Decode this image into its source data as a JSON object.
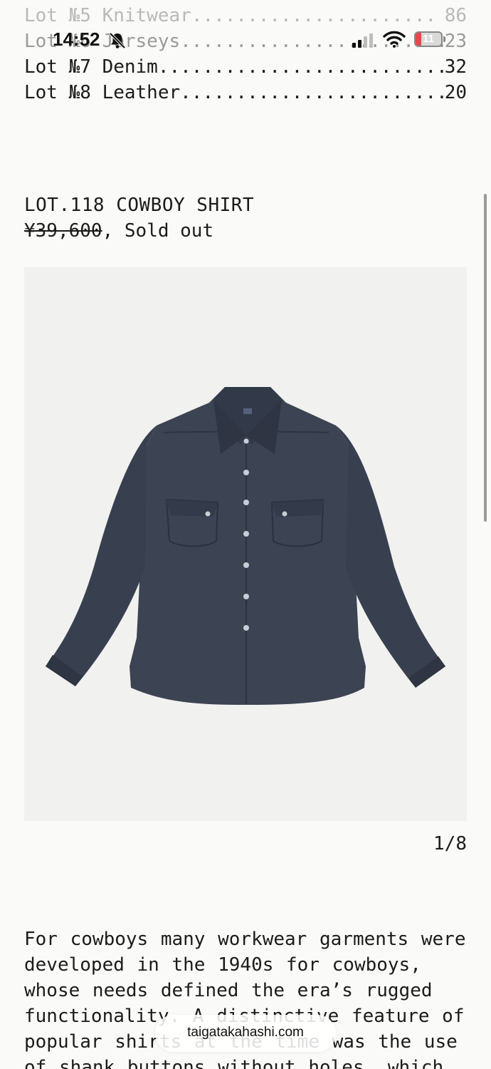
{
  "status_bar": {
    "time": "14:52",
    "battery_level": "11",
    "icons": [
      "bell-slash-icon",
      "cellular-signal-icon",
      "wifi-icon",
      "battery-icon"
    ]
  },
  "lot_index": [
    {
      "label": "Lot №5 Knitwear",
      "dots": "......................",
      "count": "86"
    },
    {
      "label": "Lot №6 Jerseys",
      "dots": "........................",
      "count": "23"
    },
    {
      "label": "Lot №7 Denim",
      "dots": "..........................",
      "count": "32"
    },
    {
      "label": "Lot №8 Leather",
      "dots": "........................",
      "count": "20"
    }
  ],
  "product": {
    "title": "LOT.118 COWBOY SHIRT",
    "price": "¥39,600",
    "availability": ", Sold out"
  },
  "gallery": {
    "counter": "1/8",
    "image_subject": "navy western cowboy shirt with snap buttons",
    "colors": {
      "background": "#f1f1ef",
      "shirt": "#3c4352",
      "shirt_shadow": "#2f3542"
    }
  },
  "description": "For cowboys many workwear garments were developed in the 1940s for cowboys, whose needs defined the era’s rugged functionality. A distinctive feature of popular shirts at the time was the use of shank buttons without holes, which",
  "url_bar": {
    "domain": "taigatakahashi.com"
  },
  "theme": {
    "page_background": "#fafaf8",
    "text": "#1b1b1b"
  }
}
